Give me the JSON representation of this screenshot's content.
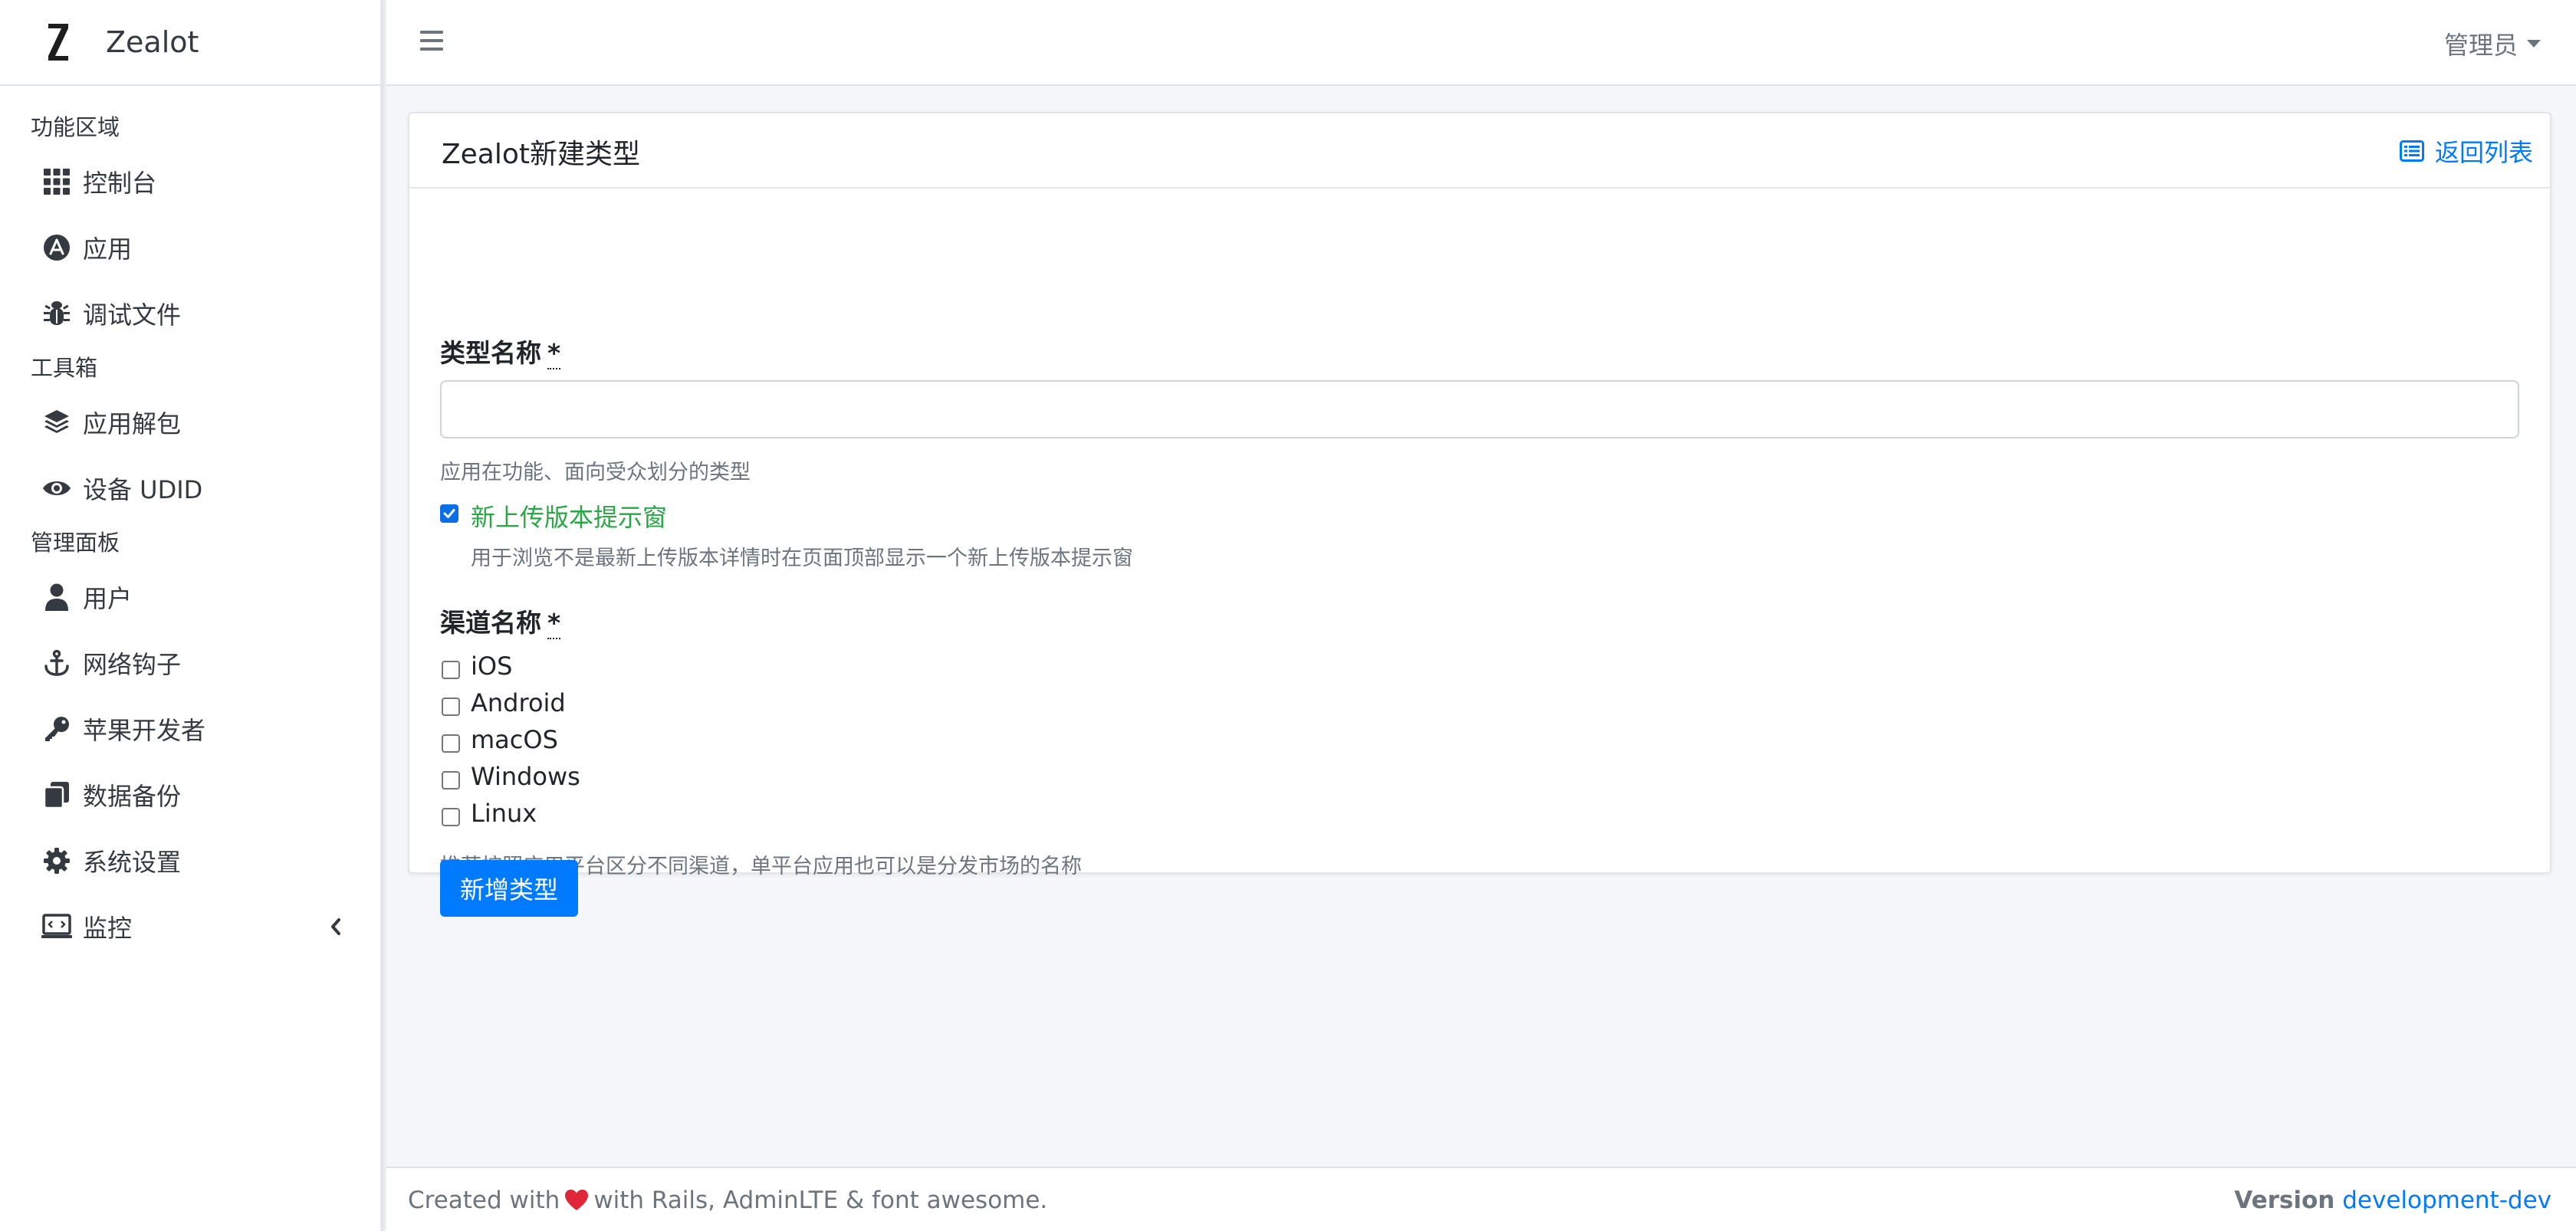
{
  "brand": {
    "logo_letter": "Z",
    "name": "Zealot"
  },
  "sidebar": {
    "sections": [
      {
        "header": "功能区域",
        "items": [
          {
            "label": "控制台",
            "icon": "grid-icon"
          },
          {
            "label": "应用",
            "icon": "app-store-icon"
          },
          {
            "label": "调试文件",
            "icon": "bug-icon"
          }
        ]
      },
      {
        "header": "工具箱",
        "items": [
          {
            "label": "应用解包",
            "icon": "layers-icon"
          },
          {
            "label": "设备 UDID",
            "icon": "eye-icon"
          }
        ]
      },
      {
        "header": "管理面板",
        "items": [
          {
            "label": "用户",
            "icon": "user-icon"
          },
          {
            "label": "网络钩子",
            "icon": "anchor-icon"
          },
          {
            "label": "苹果开发者",
            "icon": "key-icon"
          },
          {
            "label": "数据备份",
            "icon": "copy-icon"
          },
          {
            "label": "系统设置",
            "icon": "gear-icon"
          },
          {
            "label": "监控",
            "icon": "monitor-icon"
          }
        ]
      }
    ]
  },
  "navbar": {
    "user_label": "管理员"
  },
  "card": {
    "title": "Zealot新建类型",
    "back_link": "返回列表"
  },
  "form": {
    "name_label": "类型名称",
    "required_mark": "*",
    "name_value": "",
    "name_help": "应用在功能、面向受众划分的类型",
    "popup_label": "新上传版本提示窗",
    "popup_checked": true,
    "popup_help": "用于浏览不是最新上传版本详情时在页面顶部显示一个新上传版本提示窗",
    "channel_label": "渠道名称",
    "channels": [
      {
        "label": "iOS",
        "checked": false
      },
      {
        "label": "Android",
        "checked": false
      },
      {
        "label": "macOS",
        "checked": false
      },
      {
        "label": "Windows",
        "checked": false
      },
      {
        "label": "Linux",
        "checked": false
      }
    ],
    "channel_help": "推荐按照应用平台区分不同渠道，单平台应用也可以是分发市场的名称",
    "submit_label": "新增类型"
  },
  "footer": {
    "created_prefix": "Created with",
    "created_suffix": "with Rails, AdminLTE & font awesome.",
    "version_label": "Version",
    "version_value": "development-dev"
  },
  "colors": {
    "accent": "#007bff",
    "success": "#28a745",
    "heart": "#e0273a"
  }
}
